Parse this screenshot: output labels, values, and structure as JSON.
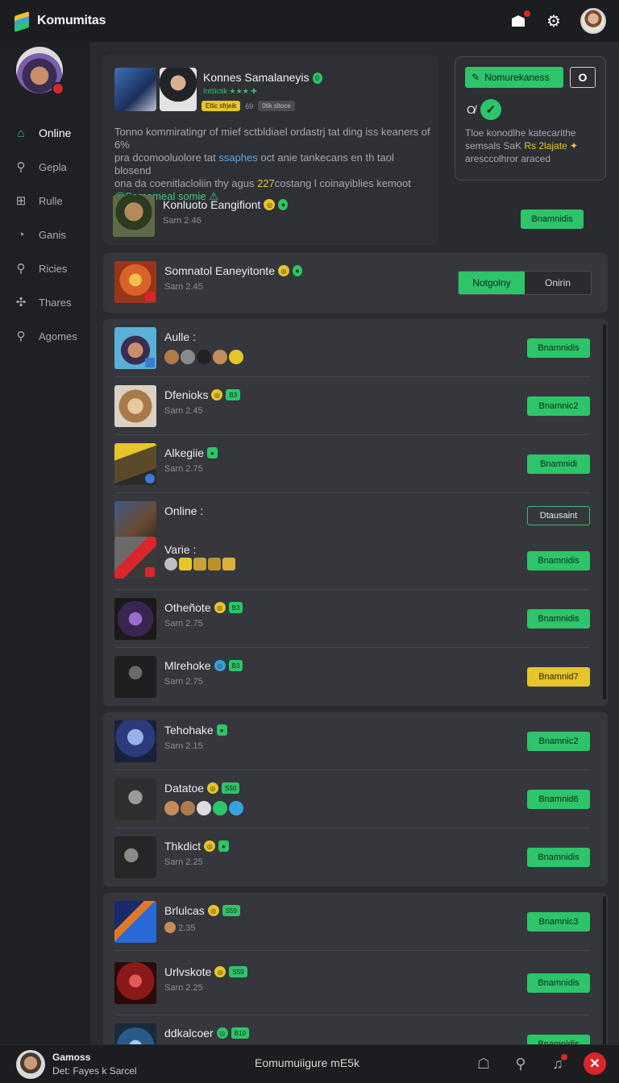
{
  "app": {
    "title": "Komumitas"
  },
  "nav": [
    {
      "label": "Online",
      "icon": "home-icon",
      "active": true
    },
    {
      "label": "Gepla",
      "icon": "wrench-icon"
    },
    {
      "label": "Rulle",
      "icon": "grid-icon"
    },
    {
      "label": "Ganis",
      "icon": "clock-icon"
    },
    {
      "label": "Ricies",
      "icon": "wrench-icon"
    },
    {
      "label": "Thares",
      "icon": "share-icon"
    },
    {
      "label": "Agomes",
      "icon": "search-icon"
    }
  ],
  "profile": {
    "name": "Konnes Samalaneyis",
    "verified": "0",
    "sub": "Inttiictik ★★★ ✚",
    "tag_yellow": "Eltic sfrjeik",
    "tag_count": "69",
    "tag_gray": "0tlk sltoce",
    "desc_1": "Tonno kommiratingr of mief sctbldiael ordastrj tat ding iss keaners of 6%",
    "desc_2a": "pra dcomooluolore tat ",
    "desc_2b": "ssaphes",
    "desc_2c": " oct anie tankecans en th taol blosend",
    "desc_3a": "ona da coenitlacloliin thy agus ",
    "desc_3b": "227",
    "desc_3c": "costang l coinayiblies kemoot",
    "desc_4": "@Somameal somie ⚠"
  },
  "promo": {
    "button": "Nomurekaness",
    "o_button": "O",
    "link": "O̸",
    "text_1": "Tloe konodlhe katecarithe",
    "text_2a": "semsals SaK ",
    "text_2b": "Rs 2lajate ✦",
    "text_3": "aresccolhror araced"
  },
  "featured": {
    "name": "Konluoto Eangifiont",
    "sub": "Sarn 2.46",
    "action": "Bnamnidis"
  },
  "status_card": {
    "name": "Somnatol Eaneyitonte",
    "sub": "Sarn 2.45",
    "toggle_on": "Notgolny",
    "toggle_off": "Onirin"
  },
  "list_a": [
    {
      "name": "Aulle :",
      "sub": "",
      "action": "Bnamnidis"
    },
    {
      "name": "Dfenioks",
      "sub": "Sarn 2.45",
      "action": "Bnamnic2"
    },
    {
      "name": "Alkegiie",
      "sub": "Sarn 2.75",
      "action": "Bnamnidi"
    },
    {
      "name": "Online :",
      "sub": "",
      "action": "Dtausaint"
    },
    {
      "name": "Varie :",
      "sub": "",
      "action": "Bnamnidis"
    },
    {
      "name": "Otheñote",
      "sub": "Sarn 2.75",
      "action": "Bnamnidis"
    },
    {
      "name": "Mlrehoke",
      "sub": "Sarn 2.75",
      "action": "Bnamnid7"
    }
  ],
  "list_b": [
    {
      "name": "Tehohake",
      "sub": "Sarn 2.15",
      "action": "Bnamnic2"
    },
    {
      "name": "Datatoe",
      "sub": "",
      "action": "Bnamnid6"
    },
    {
      "name": "Thkdict",
      "sub": "Sarn 2.25",
      "action": "Bnamnidis"
    }
  ],
  "list_c": [
    {
      "name": "Brlulcas",
      "sub": "2.35",
      "action": "Bnamnic3"
    },
    {
      "name": "Urlvskote",
      "sub": "Sarn 2.25",
      "action": "Bnamnidis"
    },
    {
      "name": "ddkalcoer",
      "sub": "",
      "action": "Bnamnidis"
    }
  ],
  "badges": {
    "b1": "B3",
    "b2": "S50",
    "b3": "S59",
    "b4": "B10"
  },
  "bottom": {
    "name": "Gamoss",
    "status": "Det: Fayes k Sarcel",
    "center": "Eomumuiigure mE5k"
  },
  "colors": {
    "accent": "#2dc46a",
    "warning": "#e6c42a",
    "danger": "#d9262b"
  }
}
